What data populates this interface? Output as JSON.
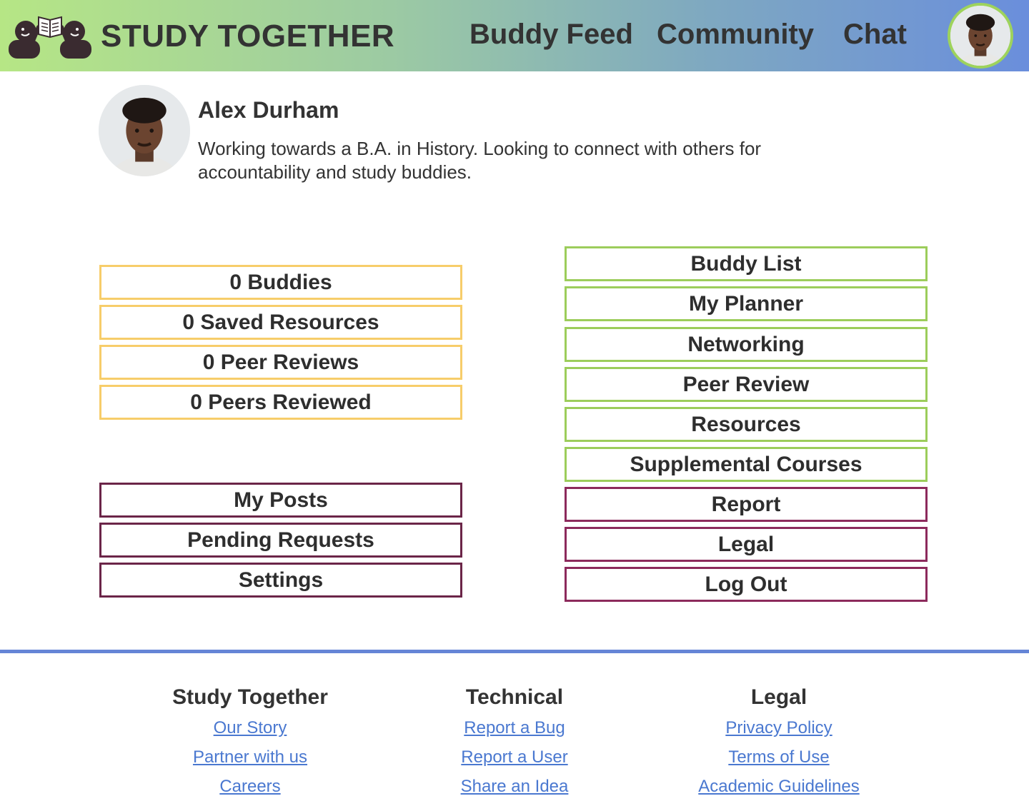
{
  "app": {
    "title": "STUDY TOGETHER",
    "logo_icon": "two-readers-book-icon"
  },
  "nav": {
    "buddy_feed": "Buddy Feed",
    "community": "Community",
    "chat": "Chat"
  },
  "profile": {
    "name": "Alex Durham",
    "bio": "Working towards a B.A. in History. Looking to connect with others for accountability and study buddies."
  },
  "stats": [
    {
      "label": "0 Buddies"
    },
    {
      "label": "0 Saved Resources"
    },
    {
      "label": "0 Peer Reviews"
    },
    {
      "label": "0 Peers Reviewed"
    }
  ],
  "account_links": [
    {
      "label": "My Posts"
    },
    {
      "label": "Pending Requests"
    },
    {
      "label": "Settings"
    }
  ],
  "menu_links": [
    {
      "label": "Buddy List"
    },
    {
      "label": "My Planner"
    },
    {
      "label": "Networking"
    },
    {
      "label": "Peer Review"
    },
    {
      "label": "Resources"
    },
    {
      "label": "Supplemental Courses"
    },
    {
      "label": "Report"
    },
    {
      "label": "Legal"
    },
    {
      "label": "Log Out"
    }
  ],
  "footer": {
    "columns": [
      {
        "heading": "Study Together",
        "links": [
          "Our Story",
          "Partner with us",
          "Careers"
        ]
      },
      {
        "heading": "Technical",
        "links": [
          "Report a Bug",
          "Report a User",
          "Share an Idea"
        ]
      },
      {
        "heading": "Legal",
        "links": [
          "Privacy Policy",
          "Terms of Use",
          "Academic Guidelines"
        ]
      }
    ]
  },
  "colors": {
    "stat_border": "#f7cd6a",
    "menu_green_border": "#9ccd5b",
    "menu_maroon_border": "#6b2548",
    "footer_line": "#6585d6",
    "link": "#4a78d0"
  }
}
